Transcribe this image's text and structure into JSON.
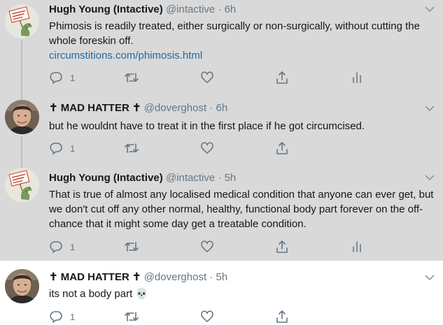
{
  "tweets": [
    {
      "name": "Hugh Young (Intactive)",
      "handle": "@intactive",
      "time": "6h",
      "text": "Phimosis is readily treated, either surgically or non-surgically, without cutting the whole foreskin off.",
      "link": "circumstitions.com/phimosis.html",
      "reply_count": "1",
      "avatar": "intactive-sign-avatar",
      "analytics": true
    },
    {
      "name": "✝ MAD HATTER ✝",
      "handle": "@doverghost",
      "time": "6h",
      "text": "but he wouldnt have to treat it in the first place if he got circumcised.",
      "reply_count": "1",
      "avatar": "man-photo-avatar",
      "analytics": false
    },
    {
      "name": "Hugh Young (Intactive)",
      "handle": "@intactive",
      "time": "5h",
      "text": "That is true of almost any localised medical condition that anyone can ever get, but we don't cut off any other normal, healthy, functional body part forever on the off-chance that it might some day get a treatable condition.",
      "reply_count": "1",
      "avatar": "intactive-sign-avatar",
      "analytics": true
    },
    {
      "name": "✝ MAD HATTER ✝",
      "handle": "@doverghost",
      "time": "5h",
      "text": "its not a body part 💀",
      "reply_count": "1",
      "avatar": "man-photo-avatar",
      "analytics": false
    }
  ],
  "colors": {
    "grey_bg": "#d9d9d9",
    "link": "#1b6aa8",
    "muted": "#657786"
  },
  "dot": "·"
}
